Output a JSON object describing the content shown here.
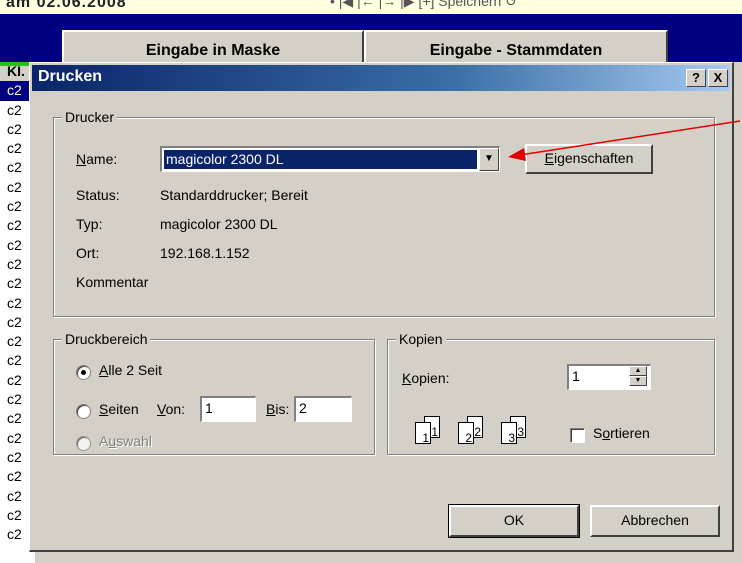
{
  "background_app": {
    "top_text": "am 02.06.2008",
    "toolbar_text": "•   |◀   |←   |→   |▶   [+] Speichern     ↺",
    "tabs": [
      "Eingabe in Maske",
      "Eingabe - Stammdaten"
    ],
    "left_column_header": "KI.",
    "left_column_cells": [
      "c2",
      "c2",
      "c2",
      "c2",
      "c2",
      "c2",
      "c2",
      "c2",
      "c2",
      "c2",
      "c2",
      "c2",
      "c2",
      "c2",
      "c2",
      "c2",
      "c2",
      "c2",
      "c2",
      "c2",
      "c2",
      "c2",
      "c2",
      "c2"
    ]
  },
  "dialog": {
    "title": "Drucken",
    "help_button": "?",
    "close_button": "X",
    "printer_group": {
      "label": "Drucker",
      "name_label_u": "N",
      "name_label_rest": "ame:",
      "selected_printer": "magicolor 2300 DL",
      "properties_button_u": "E",
      "properties_button_rest": "igenschaften",
      "status_label": "Status:",
      "status_value": "Standarddrucker; Bereit",
      "type_label": "Typ:",
      "type_value": "magicolor 2300 DL",
      "location_label": "Ort:",
      "location_value": "192.168.1.152",
      "comment_label": "Kommentar"
    },
    "range_group": {
      "label": "Druckbereich",
      "all_u": "A",
      "all_rest": "lle 2 Seit",
      "pages_u": "S",
      "pages_rest": "eiten",
      "from_label_u": "V",
      "from_label_rest": "on:",
      "from_value": "1",
      "to_label_u": "B",
      "to_label_rest": "is:",
      "to_value": "2",
      "selection_u": "u",
      "selection_pre": "A",
      "selection_rest": "swahl",
      "selected_option": "all"
    },
    "copies_group": {
      "label": "Kopien",
      "copies_label_u": "K",
      "copies_label_rest": "opien:",
      "copies_value": "1",
      "page_icons": [
        "1",
        "1",
        "2",
        "2",
        "3",
        "3"
      ],
      "collate_label_pre": "S",
      "collate_label_u": "o",
      "collate_label_rest": "rtieren",
      "collate_checked": false
    },
    "ok_button": "OK",
    "cancel_button": "Abbrechen"
  },
  "annotation": {
    "arrow_color": "#e00000"
  }
}
